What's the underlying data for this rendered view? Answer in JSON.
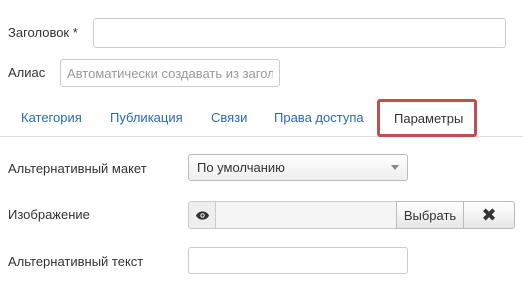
{
  "form": {
    "title_label": "Заголовок *",
    "title_value": "",
    "alias_label": "Алиас",
    "alias_placeholder": "Автоматически создавать из заголовка"
  },
  "tabs": [
    {
      "label": "Категория"
    },
    {
      "label": "Публикация"
    },
    {
      "label": "Связи"
    },
    {
      "label": "Права доступа"
    },
    {
      "label": "Параметры",
      "active": true
    }
  ],
  "params": {
    "layout_label": "Альтернативный макет",
    "layout_value": "По умолчанию",
    "image_label": "Изображение",
    "image_value": "",
    "select_button": "Выбрать",
    "clear_button": "✖",
    "alt_text_label": "Альтернативный текст",
    "alt_text_value": ""
  },
  "colors": {
    "tab_link": "#2a69b8",
    "active_tab_highlight": "#c0504d"
  },
  "icons": {
    "preview": "eye-icon",
    "clear": "close-icon",
    "dropdown": "chevron-down-icon"
  }
}
